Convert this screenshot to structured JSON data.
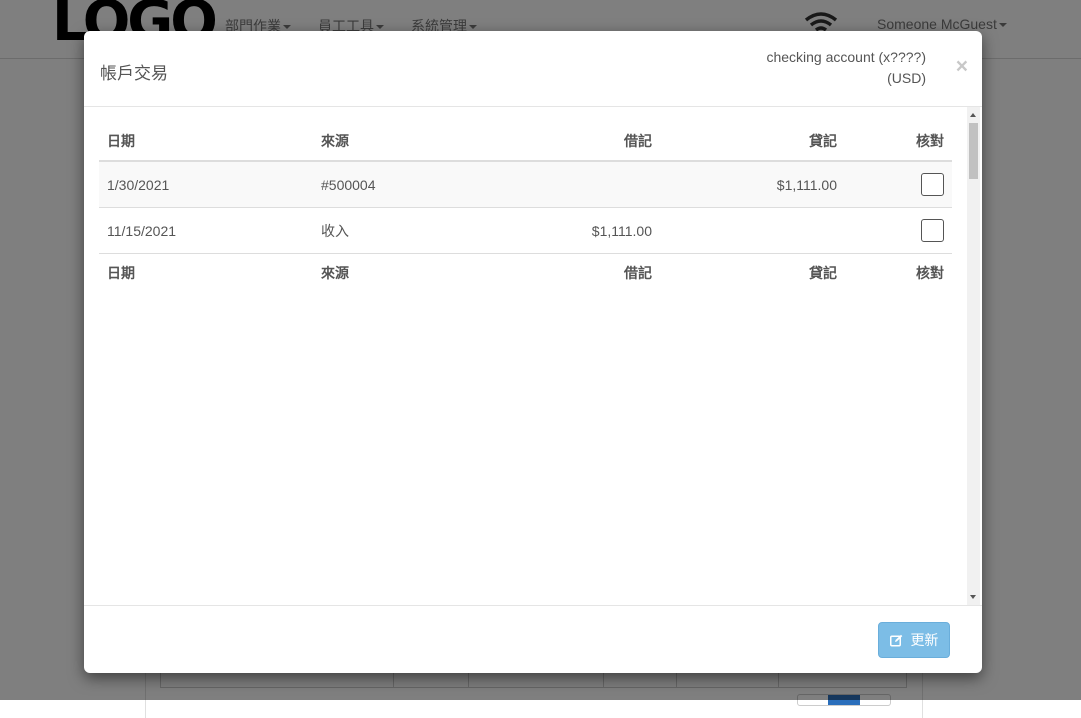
{
  "navbar": {
    "logo_text": "LOGO",
    "menu": [
      {
        "label": "部門作業"
      },
      {
        "label": "員工工具"
      },
      {
        "label": "系統管理"
      }
    ],
    "user_name": "Someone McGuest"
  },
  "modal": {
    "title": "帳戶交易",
    "account_name": "checking account (x????)",
    "account_currency": "(USD)",
    "close_label": "×",
    "table": {
      "headers": [
        "日期",
        "來源",
        "借記",
        "貸記",
        "核對"
      ],
      "rows": [
        {
          "date": "1/30/2021",
          "source": "#500004",
          "debit": "",
          "credit": "$1,111.00",
          "reconciled": false
        },
        {
          "date": "11/15/2021",
          "source": "收入",
          "debit": "$1,111.00",
          "credit": "",
          "reconciled": false
        }
      ]
    },
    "update_button_label": "更新",
    "update_button_icon": "edit-icon"
  },
  "colors": {
    "backdrop": "#000000",
    "update_button": "#7cbde6",
    "pager_active": "#2a6ebb"
  }
}
